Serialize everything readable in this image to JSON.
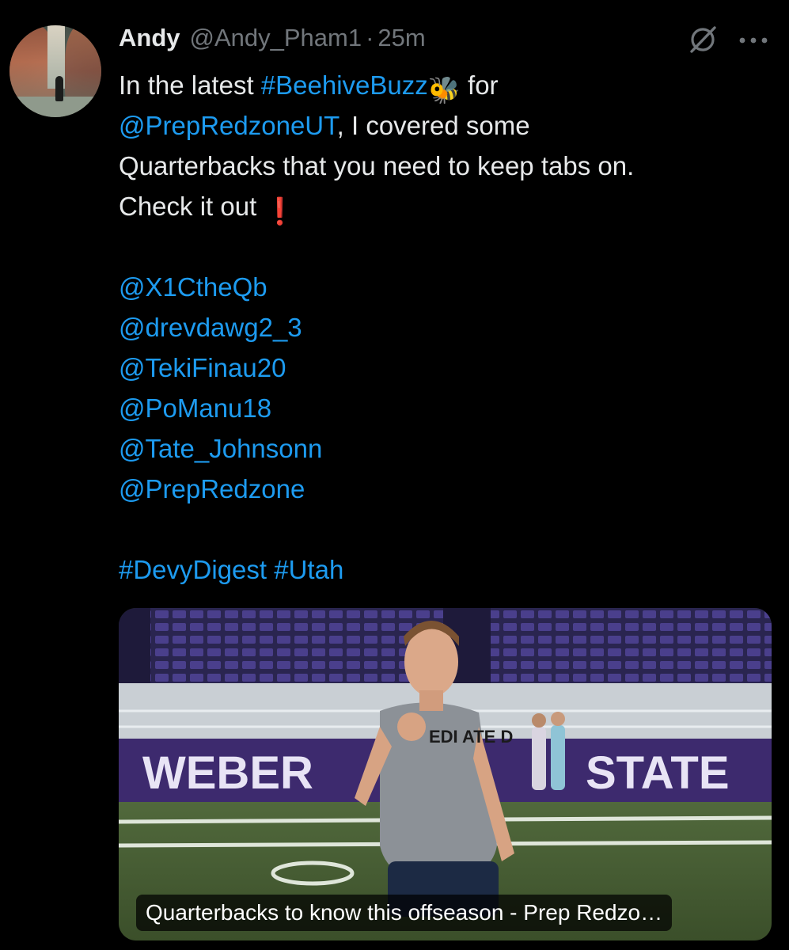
{
  "author": {
    "name": "Andy",
    "handle": "@Andy_Pham1",
    "separator": "·",
    "time": "25m",
    "avatar_icon": "profile-photo-canyon"
  },
  "actions": {
    "grok_icon": "grok-icon",
    "more_icon": "more-options-icon"
  },
  "tweet": {
    "line1_prefix": "In the latest ",
    "hashtag_beehive": "#BeehiveBuzz",
    "bee_emoji": "🐝",
    "line1_suffix": " for",
    "mention_prepredzoneut": "@PrepRedzoneUT",
    "line2_suffix": ", I covered some",
    "line3": "Quarterbacks that you need to keep tabs on.",
    "line4": "Check it out ",
    "exclamation_emoji": "❗",
    "mentions": [
      "@X1CtheQb",
      "@drevdawg2_3",
      "@TekiFinau20",
      "@PoManu18",
      "@Tate_Johnsonn",
      "@PrepRedzone"
    ],
    "hashtag_devy": "#DevyDigest",
    "hashtag_utah": "#Utah"
  },
  "media": {
    "caption": "Quarterbacks to know this offseason - Prep Redzo…",
    "banner_left": "WEBER",
    "banner_right": "STATE",
    "shirt_text": "EDI ATE D"
  },
  "colors": {
    "background": "#000000",
    "text": "#e7e9ea",
    "muted": "#71767b",
    "link": "#1d9bf0",
    "stadium_purple": "#4b2e83"
  }
}
